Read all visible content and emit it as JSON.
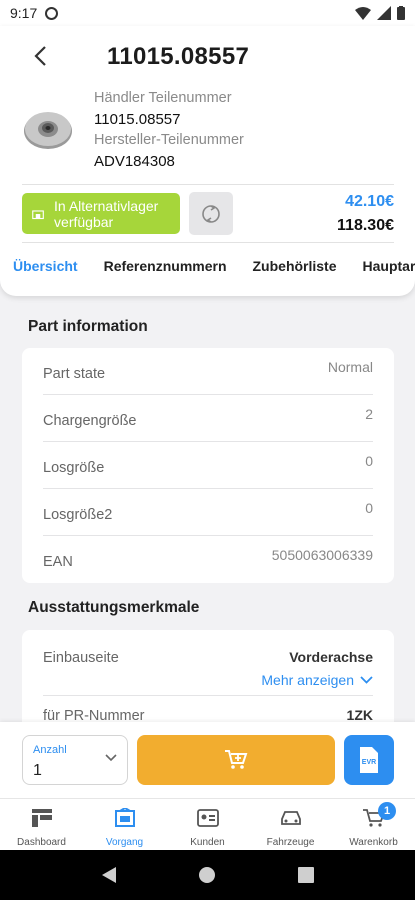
{
  "status_bar": {
    "time": "9:17"
  },
  "header": {
    "title": "11015.08557",
    "dealer_part_label": "Händler Teilenummer",
    "dealer_part_value": "11015.08557",
    "manufacturer_part_label": "Hersteller-Teilenummer",
    "manufacturer_part_value": "ADV184308",
    "stock_status": "In Alternativlager verfügbar",
    "price_net": "42.10€",
    "price_gross": "118.30€"
  },
  "tabs": [
    {
      "label": "Übersicht",
      "active": true
    },
    {
      "label": "Referenznummern",
      "active": false
    },
    {
      "label": "Zubehörliste",
      "active": false
    },
    {
      "label": "Hauptartikel",
      "active": false
    }
  ],
  "part_information": {
    "title": "Part information",
    "rows": [
      {
        "label": "Part state",
        "value": "Normal"
      },
      {
        "label": "Chargengröße",
        "value": "2"
      },
      {
        "label": "Losgröße",
        "value": "0"
      },
      {
        "label": "Losgröße2",
        "value": "0"
      },
      {
        "label": "EAN",
        "value": "5050063006339"
      }
    ]
  },
  "features": {
    "title": "Ausstattungsmerkmale",
    "rows": [
      {
        "label": "Einbauseite",
        "value": "Vorderachse",
        "more": "Mehr anzeigen"
      },
      {
        "label": "für PR-Nummer",
        "value": "1ZK"
      }
    ]
  },
  "action_bar": {
    "quantity_label": "Anzahl",
    "quantity_value": "1",
    "evr_label": "EVR"
  },
  "bottom_nav": {
    "items": [
      {
        "label": "Dashboard",
        "icon": "dashboard-icon",
        "active": false
      },
      {
        "label": "Vorgang",
        "icon": "process-icon",
        "active": true
      },
      {
        "label": "Kunden",
        "icon": "customer-card-icon",
        "active": false
      },
      {
        "label": "Fahrzeuge",
        "icon": "car-icon",
        "active": false
      },
      {
        "label": "Warenkorb",
        "icon": "cart-icon",
        "active": false
      }
    ],
    "cart_badge": "1"
  },
  "colors": {
    "accent": "#2d8ef0",
    "stock_green": "#a6d63a",
    "cart_orange": "#f2ad2f"
  }
}
